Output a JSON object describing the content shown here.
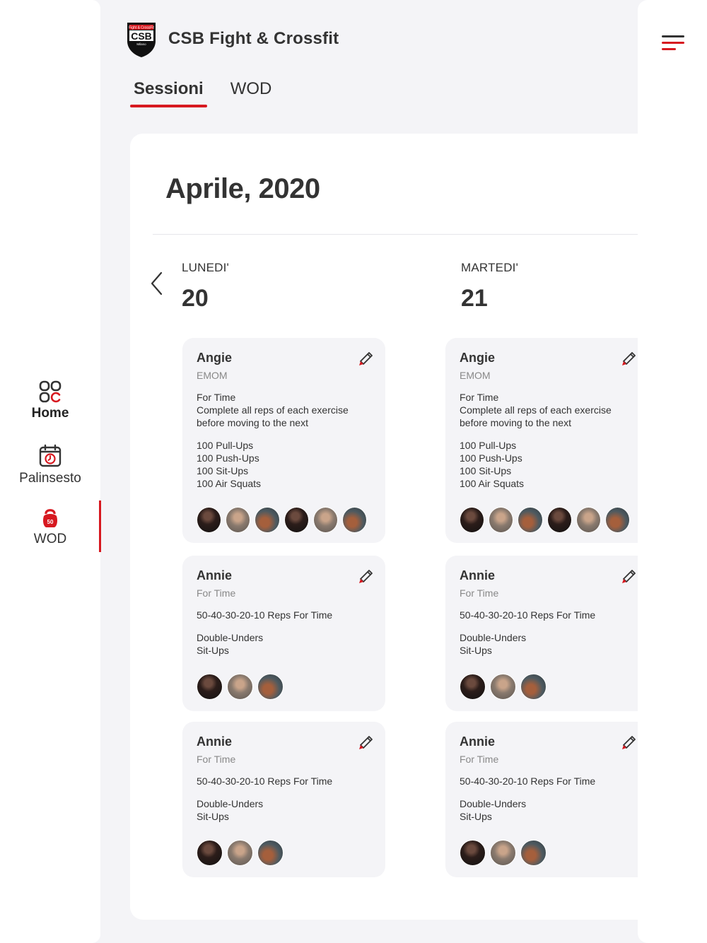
{
  "app": {
    "brand_title": "CSB Fight & Crossfit",
    "logo": {
      "top_text": "Fight & CrossFit",
      "main_text": "CSB",
      "bottom_text": "Milano"
    }
  },
  "colors": {
    "accent": "#d71920",
    "background": "#f4f4f7",
    "card": "#ffffff"
  },
  "tabs": [
    {
      "label": "Sessioni",
      "active": true
    },
    {
      "label": "WOD",
      "active": false
    }
  ],
  "sidebar": {
    "items": [
      {
        "label": "Home",
        "icon": "home-grid-icon"
      },
      {
        "label": "Palinsesto",
        "icon": "calendar-icon"
      },
      {
        "label": "WOD",
        "icon": "kettlebell-icon",
        "badge": "50",
        "active": true
      }
    ]
  },
  "calendar": {
    "month_title": "Aprile, 2020",
    "days": [
      {
        "name": "LUNEDI'",
        "number": "20",
        "wods": [
          {
            "name": "Angie",
            "type": "EMOM",
            "description": "For Time\nComplete all reps of each exercise\nbefore moving to the next",
            "exercises": "100 Pull-Ups\n100 Push-Ups\n100 Sit-Ups\n100 Air Squats",
            "participants": 6
          },
          {
            "name": "Annie",
            "type": "For Time",
            "description": "50-40-30-20-10 Reps For Time",
            "exercises": "Double-Unders\nSit-Ups",
            "participants": 3
          },
          {
            "name": "Annie",
            "type": "For Time",
            "description": "50-40-30-20-10 Reps For Time",
            "exercises": "Double-Unders\nSit-Ups",
            "participants": 3
          }
        ]
      },
      {
        "name": "MARTEDI'",
        "number": "21",
        "wods": [
          {
            "name": "Angie",
            "type": "EMOM",
            "description": "For Time\nComplete all reps of each exercise\nbefore moving to the next",
            "exercises": "100 Pull-Ups\n100 Push-Ups\n100 Sit-Ups\n100 Air Squats",
            "participants": 6
          },
          {
            "name": "Annie",
            "type": "For Time",
            "description": "50-40-30-20-10 Reps For Time",
            "exercises": "Double-Unders\nSit-Ups",
            "participants": 3
          },
          {
            "name": "Annie",
            "type": "For Time",
            "description": "50-40-30-20-10 Reps For Time",
            "exercises": "Double-Unders\nSit-Ups",
            "participants": 3
          }
        ]
      }
    ]
  }
}
